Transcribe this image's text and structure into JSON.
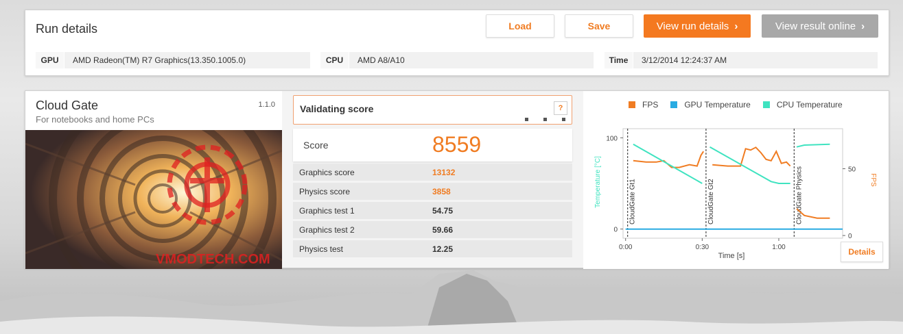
{
  "run": {
    "title": "Run details",
    "buttons": {
      "load": "Load",
      "save": "Save",
      "view_details": "View run details",
      "view_online": "View result online"
    },
    "gpu": {
      "label": "GPU",
      "value": "AMD Radeon(TM) R7 Graphics(13.350.1005.0)"
    },
    "cpu": {
      "label": "CPU",
      "value": "AMD A8/A10"
    },
    "time": {
      "label": "Time",
      "value": "3/12/2014 12:24:37 AM"
    }
  },
  "benchmark": {
    "name": "Cloud Gate",
    "version": "1.1.0",
    "subtitle": "For notebooks and home PCs",
    "watermark": "VMODTECH.COM"
  },
  "score": {
    "validating": "Validating score",
    "help": "?",
    "score_label": "Score",
    "score_value": "8559",
    "rows": [
      {
        "label": "Graphics score",
        "value": "13132"
      },
      {
        "label": "Physics score",
        "value": "3858"
      },
      {
        "label": "Graphics test 1",
        "value": "54.75"
      },
      {
        "label": "Graphics test 2",
        "value": "59.66"
      },
      {
        "label": "Physics test",
        "value": "12.25"
      }
    ]
  },
  "chart_panel": {
    "details_button": "Details"
  },
  "colors": {
    "accent": "#f47920",
    "fps": "#f07c22",
    "gpu_temp": "#29abe2",
    "cpu_temp": "#3fe3c0"
  },
  "chart_data": {
    "type": "line",
    "legend": [
      "FPS",
      "GPU Temperature",
      "CPU Temperature"
    ],
    "xlabel": "Time [s]",
    "ylabel_left": "Temperature [°C]",
    "ylabel_right": "FPS",
    "x_ticks": [
      "0:00",
      "0:30",
      "1:00"
    ],
    "y_left_ticks": [
      "0",
      "100"
    ],
    "y_right_ticks": [
      "0",
      "50"
    ],
    "y_left_range": [
      -10,
      110
    ],
    "y_right_range": [
      -2,
      80
    ],
    "x_range": [
      -1,
      85
    ],
    "segments": [
      {
        "label": "CloudGate Gt1",
        "start": 0
      },
      {
        "label": "CloudGate Gt2",
        "start": 31.5
      },
      {
        "label": "CloudGate Physics",
        "start": 66
      }
    ],
    "series": [
      {
        "name": "FPS",
        "axis": "right",
        "x": [
          3,
          8,
          12,
          15,
          18,
          21,
          25,
          28,
          29.5,
          30.5,
          34,
          40,
          45,
          47,
          49,
          51,
          53,
          55,
          57,
          59,
          61,
          63,
          64.5,
          67,
          70,
          75,
          80
        ],
        "y": [
          56,
          55,
          55,
          56,
          51,
          51,
          53,
          52,
          60,
          63,
          53,
          52,
          52,
          65,
          64,
          66,
          62,
          57,
          56,
          63,
          54,
          55,
          52,
          20,
          15,
          13,
          13
        ]
      },
      {
        "name": "GPU Temperature",
        "axis": "left",
        "x": [
          0,
          30.5,
          31.5,
          64.5,
          66,
          85
        ],
        "y": [
          0,
          0,
          0,
          0,
          0,
          0
        ]
      },
      {
        "name": "CPU Temperature",
        "axis": "left",
        "x": [
          3,
          30,
          33,
          57,
          60,
          64.5,
          67,
          70,
          80
        ],
        "y": [
          93,
          50,
          90,
          52,
          50,
          50,
          90,
          92,
          93
        ]
      }
    ]
  }
}
